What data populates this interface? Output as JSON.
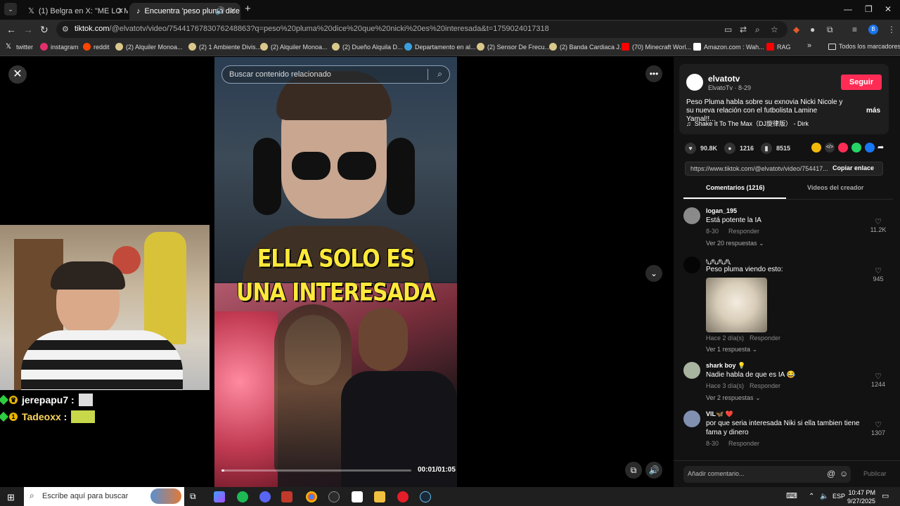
{
  "tabs": [
    {
      "title": "(1) Belgra en X: \"ME LO MAND",
      "favicon": "x-icon"
    },
    {
      "title": "Encuentra 'peso pluma dice",
      "favicon": "tiktok-icon",
      "active": true
    }
  ],
  "address_bar": {
    "host": "tiktok.com",
    "path": "/@elvatotv/video/7544176783076248863?q=peso%20pluma%20dice%20que%20nicki%20es%20interesada&t=1759024017318"
  },
  "bookmarks": [
    {
      "label": "twitter",
      "color": "#ffffff"
    },
    {
      "label": "instagram",
      "color": "#e1306c"
    },
    {
      "label": "reddit",
      "color": "#ff4500"
    },
    {
      "label": "(2) Alquiler Monoa...",
      "color": "#d9c88a"
    },
    {
      "label": "(2) 1 Ambiente Divis...",
      "color": "#d9c88a"
    },
    {
      "label": "(2) Alquiler Monoa...",
      "color": "#d9c88a"
    },
    {
      "label": "(2) Dueño Alquila D...",
      "color": "#d9c88a"
    },
    {
      "label": "Departamento en al...",
      "color": "#3aa0e0"
    },
    {
      "label": "(2) Sensor De Frecu...",
      "color": "#d9c88a"
    },
    {
      "label": "(2) Banda Cardiaca J...",
      "color": "#d9c88a"
    },
    {
      "label": "(70) Minecraft Worl...",
      "color": "#ff0000"
    },
    {
      "label": "Amazon.com : Wah...",
      "color": "#ffffff"
    },
    {
      "label": "RAG",
      "color": "#ff0000"
    }
  ],
  "bookmarks_more": "»",
  "bookmarks_all": "Todos los marcadores",
  "chat": [
    {
      "user": "jerepapu7",
      "sep": ":"
    },
    {
      "user": "Tadeoxx",
      "sep": ":",
      "badge": "1"
    }
  ],
  "video": {
    "search_placeholder": "Buscar contenido relacionado",
    "caption_line1": "ELLA SOLO ES",
    "caption_line2": "UNA INTERESADA",
    "timecode": "00:01/01:05",
    "progress": 0.015
  },
  "author": {
    "name": "elvatotv",
    "handle": "ElvatoTv",
    "date": "8-29",
    "follow_label": "Seguir",
    "description": "Peso Pluma habla sobre su exnovia Nicki Nicole y su nueva relación con el futbolista Lamine Yamal!!...",
    "more_label": "más",
    "music": "Shake It To The Max（DJ旋律版） - Dirk"
  },
  "stats": {
    "likes": "90.8K",
    "comments": "1216",
    "saves": "8515"
  },
  "link": {
    "url": "https://www.tiktok.com/@elvatotv/video/754417...",
    "copy_label": "Copiar enlace"
  },
  "panel_tabs": {
    "comments": "Comentarios (1216)",
    "creator_videos": "Videos del creador"
  },
  "comments": [
    {
      "user": "logan_195",
      "text": "Está potente la IA",
      "date": "8-30",
      "reply_label": "Responder",
      "replies": "Ver 20 respuestas",
      "likes": "11.2K"
    },
    {
      "user": "𓆩𓆪𓆩𓆪𓆩𓆪𓆩",
      "text": "Peso pluma viendo esto:",
      "date": "Hace 2 día(s)",
      "reply_label": "Responder",
      "replies": "Ver 1 respuesta",
      "likes": "945"
    },
    {
      "user": "shark boy 💡",
      "text": "Nadie habla de que es IA 😂",
      "date": "Hace 3 día(s)",
      "reply_label": "Responder",
      "replies": "Ver 2 respuestas",
      "likes": "1244"
    },
    {
      "user": "VIL🦋 ❤️",
      "text": "por que seria interesada Niki si ella tambien tiene fama y dinero",
      "date": "8-30",
      "reply_label": "Responder",
      "replies": "",
      "likes": "1307"
    }
  ],
  "compose": {
    "placeholder": "Añadir comentario...",
    "publish_label": "Publicar"
  },
  "taskbar": {
    "search_placeholder": "Escribe aquí para buscar",
    "lang": "ESP",
    "time": "10:47 PM",
    "date": "9/27/2025"
  },
  "colors": {
    "accent_follow": "#fe2c55",
    "caption_yellow": "#ffe93b"
  }
}
